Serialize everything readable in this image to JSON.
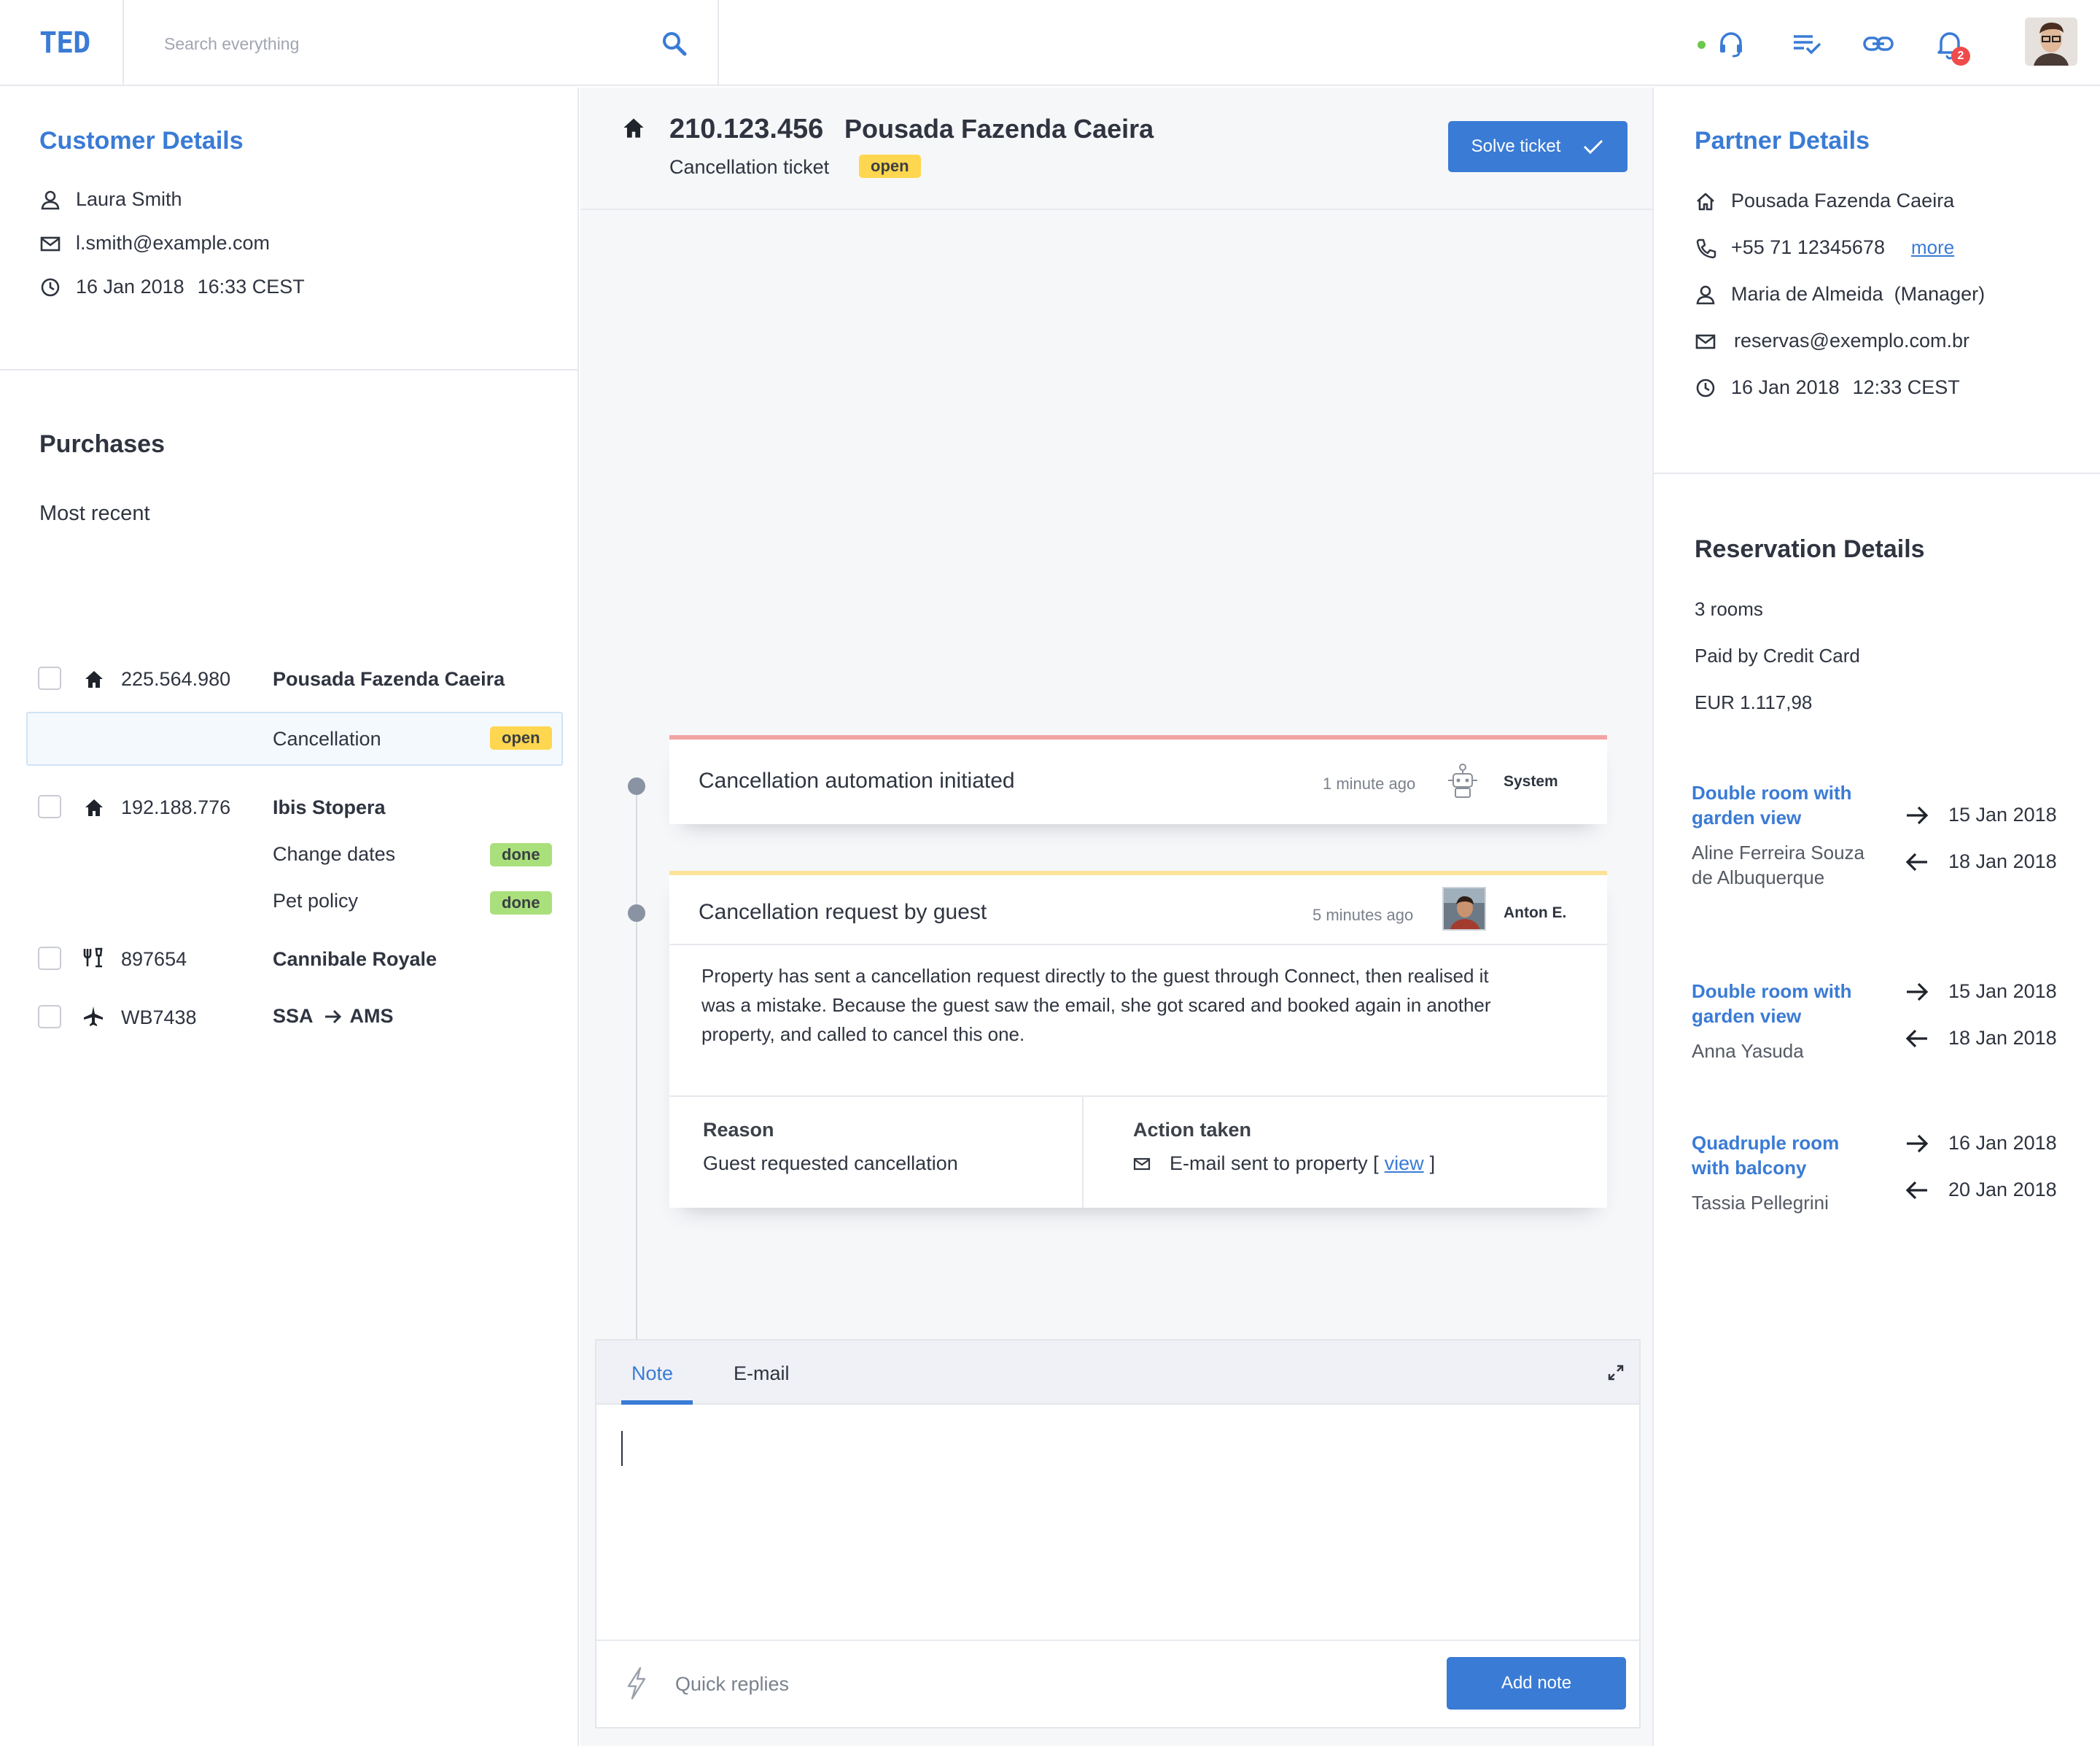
{
  "app": {
    "logo": "TED"
  },
  "search": {
    "placeholder": "Search everything"
  },
  "notifications": {
    "count": "2"
  },
  "customer": {
    "title": "Customer Details",
    "name": "Laura Smith",
    "email": "l.smith@example.com",
    "date": "16 Jan 2018",
    "time": "16:33 CEST"
  },
  "purchases": {
    "title": "Purchases",
    "subtitle": "Most recent",
    "items": [
      {
        "number": "225.564.980",
        "name": "Pousada Fazenda Caeira",
        "icon": "house-icon",
        "subitems": [
          {
            "label": "Cancellation",
            "status": "open"
          }
        ]
      },
      {
        "number": "192.188.776",
        "name": "Ibis Stopera",
        "icon": "house-icon",
        "subitems": [
          {
            "label": "Change dates",
            "status": "done"
          },
          {
            "label": "Pet policy",
            "status": "done"
          }
        ]
      },
      {
        "number": "897654",
        "name": "Cannibale Royale",
        "icon": "restaurant-icon",
        "subitems": []
      },
      {
        "number": "WB7438",
        "name_from": "SSA",
        "name_to": "AMS",
        "icon": "plane-icon",
        "subitems": []
      }
    ]
  },
  "ticket": {
    "number": "210.123.456",
    "property": "Pousada Fazenda Caeira",
    "type": "Cancellation ticket",
    "status": "open",
    "solve_label": "Solve ticket"
  },
  "timeline": [
    {
      "title": "Cancellation automation initiated",
      "time": "1 minute ago",
      "author": "System",
      "accent": "#f2a3a3"
    },
    {
      "title": "Cancellation request by guest",
      "time": "5 minutes ago",
      "author": "Anton E.",
      "accent": "#fbe39a",
      "body": "Property has sent a cancellation request directly to the guest through Connect, then realised it was a mistake. Because the guest saw the email, she got scared and booked again in another property, and called to cancel this one.",
      "reason_label": "Reason",
      "reason": "Guest requested cancellation",
      "action_label": "Action taken",
      "action_prefix": "E-mail sent to property [",
      "action_link": "view",
      "action_suffix": "]"
    }
  ],
  "composer": {
    "tabs": [
      "Note",
      "E-mail"
    ],
    "quick_replies": "Quick replies",
    "add_label": "Add note"
  },
  "partner": {
    "title": "Partner Details",
    "property": "Pousada Fazenda Caeira",
    "phone": "+55 71 12345678",
    "more": "more",
    "contact": "Maria de Almeida  (Manager)",
    "email": "reservas@exemplo.com.br",
    "date": "16 Jan 2018",
    "time": "12:33 CEST"
  },
  "reservation": {
    "title": "Reservation Details",
    "rooms": "3 rooms",
    "payment": "Paid by Credit Card",
    "amount": "EUR 1.117,98",
    "items": [
      {
        "room_l1": "Double room with",
        "room_l2": "garden view",
        "guest_l1": "Aline Ferreira Souza",
        "guest_l2": "de Albuquerque",
        "checkin": "15 Jan 2018",
        "checkout": "18 Jan 2018"
      },
      {
        "room_l1": "Double room with",
        "room_l2": "garden view",
        "guest_l1": "Anna Yasuda",
        "guest_l2": "",
        "checkin": "15 Jan 2018",
        "checkout": "18 Jan 2018"
      },
      {
        "room_l1": "Quadruple room",
        "room_l2": "with balcony",
        "guest_l1": "Tassia Pellegrini",
        "guest_l2": "",
        "checkin": "16 Jan 2018",
        "checkout": "20 Jan 2018"
      }
    ]
  },
  "colors": {
    "accent": "#3a7bd5",
    "open": "#ffd64f",
    "done": "#a9e07b",
    "online": "#6cc74d",
    "alert": "#ef4b4b"
  }
}
